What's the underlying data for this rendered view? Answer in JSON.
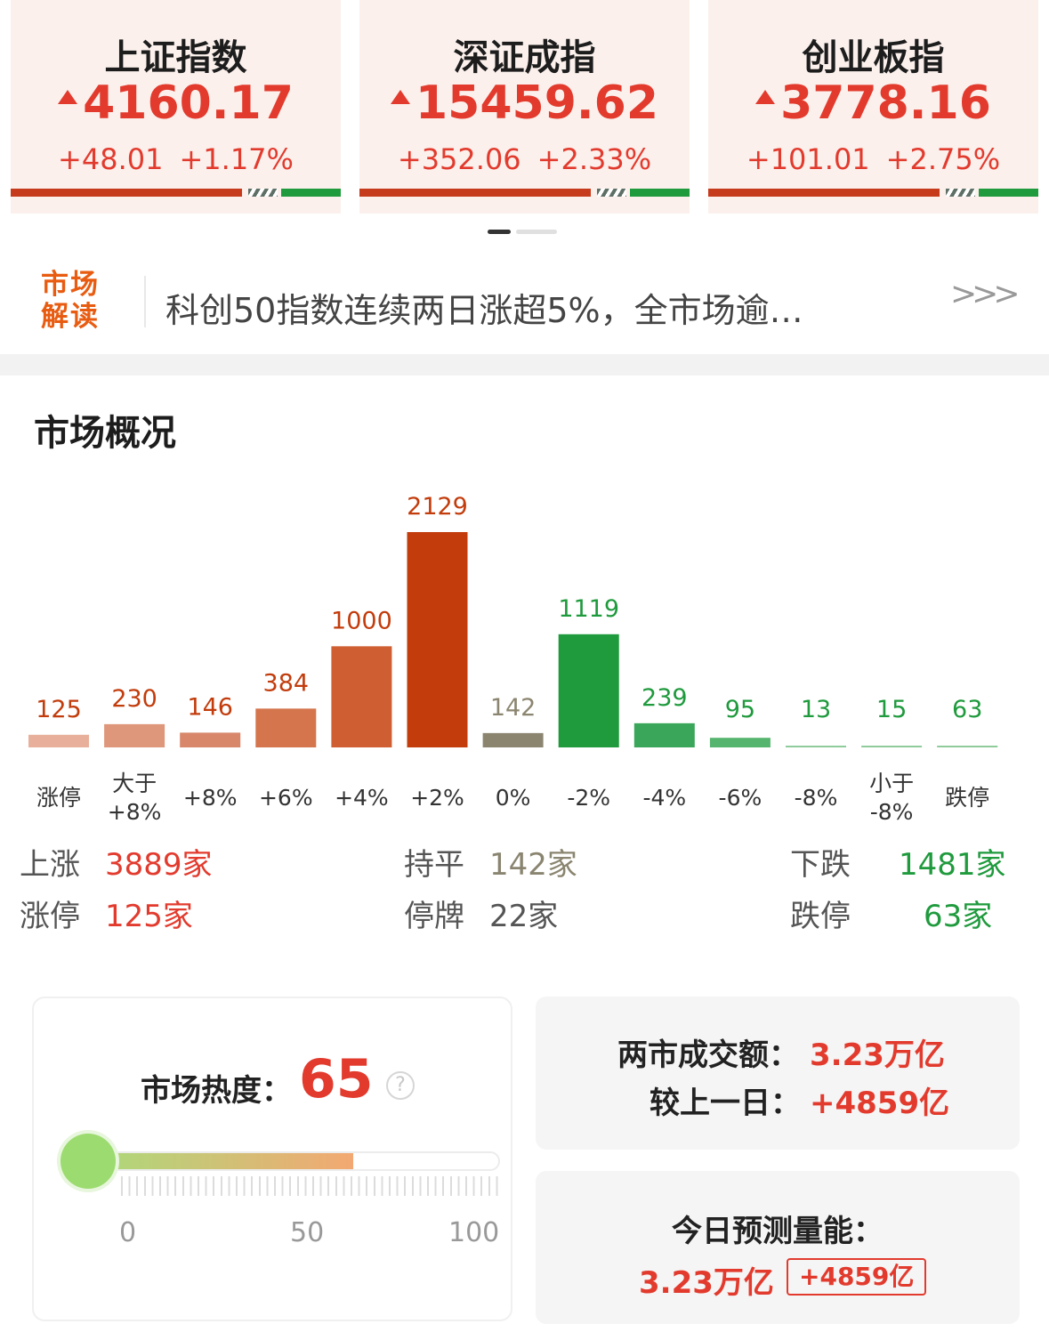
{
  "indices": [
    {
      "name": "上证指数",
      "price": "4160.17",
      "change": "+48.01",
      "pct": "+1.17%"
    },
    {
      "name": "深证成指",
      "price": "15459.62",
      "change": "+352.06",
      "pct": "+2.33%"
    },
    {
      "name": "创业板指",
      "price": "3778.16",
      "change": "+101.01",
      "pct": "+2.75%"
    }
  ],
  "colors": {
    "up": "#e23b2e",
    "down": "#1f9a3d",
    "flat": "#8a8570"
  },
  "interpretation": {
    "badge": "市场解读",
    "text": "科创50指数连续两日涨超5%，全市场逾…",
    "more_icon": "chevron-triple-right-icon"
  },
  "overview": {
    "title": "市场概况",
    "stats": [
      {
        "key": "上涨",
        "value": "3889家"
      },
      {
        "key": "持平",
        "value": "142家"
      },
      {
        "key": "下跌",
        "value": "1481家"
      },
      {
        "key": "涨停",
        "value": "125家"
      },
      {
        "key": "停牌",
        "value": "22家"
      },
      {
        "key": "跌停",
        "value": "63家"
      }
    ]
  },
  "chart_data": {
    "type": "bar",
    "categories": [
      "涨停",
      "大于\n+8%",
      "+8%",
      "+6%",
      "+4%",
      "+2%",
      "0%",
      "-2%",
      "-4%",
      "-6%",
      "-8%",
      "小于\n-8%",
      "跌停"
    ],
    "values": [
      125,
      230,
      146,
      384,
      1000,
      2129,
      142,
      1119,
      239,
      95,
      13,
      15,
      63
    ],
    "bar_colors": [
      "#e8b09a",
      "#de977a",
      "#d8876a",
      "#d4754d",
      "#cf5e32",
      "#c23c0c",
      "#8b8570",
      "#1f9a3d",
      "#3aa659",
      "#55b46e",
      "#8fcc9c",
      "#8fcc9c",
      "#8fcc9c"
    ],
    "label_colors": [
      "#c23c0c",
      "#c23c0c",
      "#c23c0c",
      "#c23c0c",
      "#c23c0c",
      "#c23c0c",
      "#8b8570",
      "#1f9a3d",
      "#1f9a3d",
      "#1f9a3d",
      "#1f9a3d",
      "#1f9a3d",
      "#1f9a3d"
    ]
  },
  "heat": {
    "label": "市场热度：",
    "value": "65",
    "level": 0.65,
    "help_icon": "question-circle-icon",
    "help_glyph": "?",
    "ticks": [
      "0",
      "50",
      "100"
    ]
  },
  "turnover": {
    "label1": "两市成交额：",
    "value1": "3.23万亿",
    "label2": "较上一日：",
    "value2": "+4859亿"
  },
  "forecast": {
    "title": "今日预测量能：",
    "value": "3.23万亿",
    "delta": "+4859亿"
  }
}
